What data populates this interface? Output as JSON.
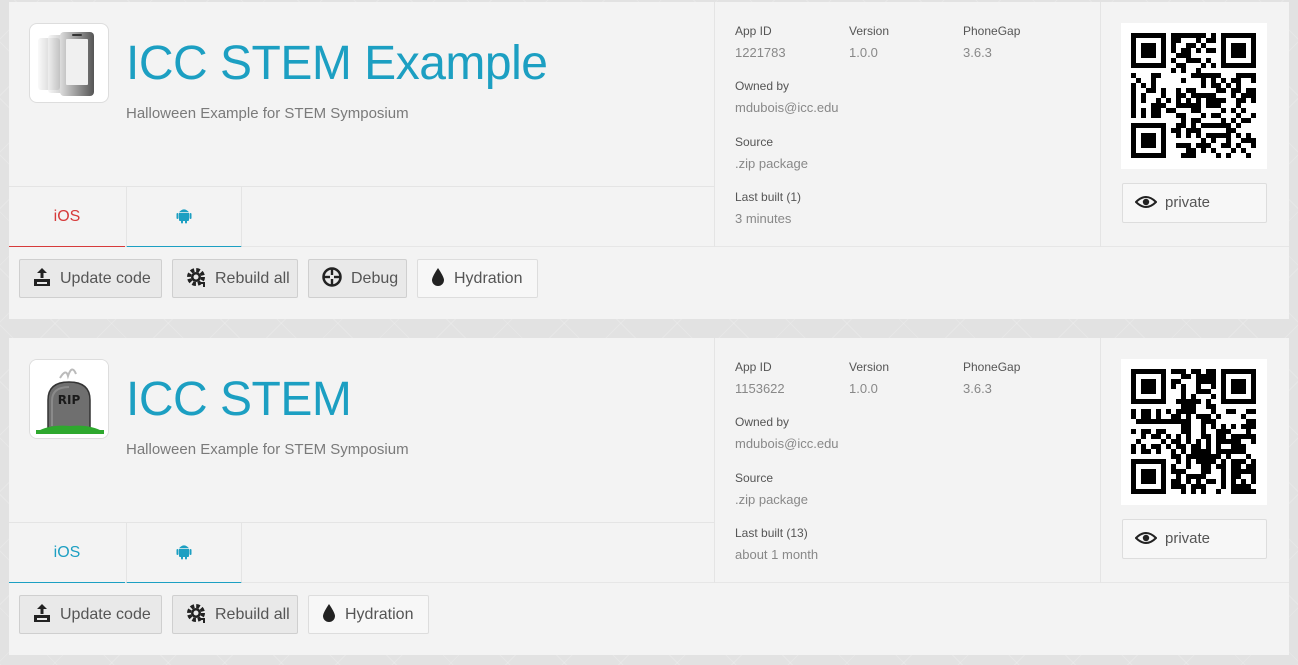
{
  "apps": [
    {
      "name": "ICC STEM Example",
      "description": "Halloween Example for STEM Symposium",
      "icon": "phonegap-icon",
      "tabs": {
        "ios": "iOS",
        "android": "android-icon"
      },
      "active_tab_color": "#d63a3a",
      "meta": {
        "app_id_label": "App ID",
        "app_id": "1221783",
        "version_label": "Version",
        "version": "1.0.0",
        "phonegap_label": "PhoneGap",
        "phonegap": "3.6.3",
        "owned_label": "Owned by",
        "owned": "mdubois@icc.edu",
        "source_label": "Source",
        "source": ".zip package",
        "last_built_label": "Last built (1)",
        "last_built": "3 minutes"
      },
      "privacy": "private",
      "buttons": {
        "update": "Update code",
        "rebuild": "Rebuild all",
        "debug": "Debug",
        "hydration": "Hydration"
      }
    },
    {
      "name": "ICC STEM",
      "description": "Halloween Example for STEM Symposium",
      "icon": "tombstone-icon",
      "icon_text": "RIP",
      "tabs": {
        "ios": "iOS",
        "android": "android-icon"
      },
      "active_tab_color": "#1c9fc2",
      "meta": {
        "app_id_label": "App ID",
        "app_id": "1153622",
        "version_label": "Version",
        "version": "1.0.0",
        "phonegap_label": "PhoneGap",
        "phonegap": "3.6.3",
        "owned_label": "Owned by",
        "owned": "mdubois@icc.edu",
        "source_label": "Source",
        "source": ".zip package",
        "last_built_label": "Last built (13)",
        "last_built": "about 1 month"
      },
      "privacy": "private",
      "buttons": {
        "update": "Update code",
        "rebuild": "Rebuild all",
        "hydration": "Hydration"
      }
    }
  ],
  "colors": {
    "accent": "#1c9fc2",
    "error": "#d63a3a"
  }
}
